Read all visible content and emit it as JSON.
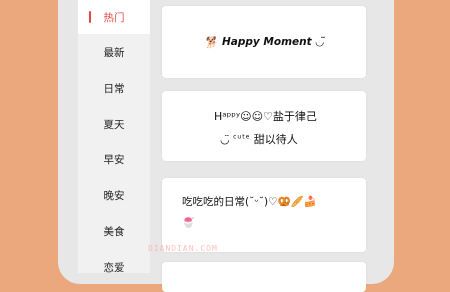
{
  "sidebar": {
    "items": [
      {
        "label": "热门",
        "active": true
      },
      {
        "label": "最新"
      },
      {
        "label": "日常"
      },
      {
        "label": "夏天"
      },
      {
        "label": "早安"
      },
      {
        "label": "晚安"
      },
      {
        "label": "美食"
      },
      {
        "label": "恋爱"
      }
    ]
  },
  "cards": [
    {
      "icon": "🐕",
      "text": "Happy Moment",
      "suffix": "◡̈"
    },
    {
      "line1_prefix": "Hᵃᵖᵖʸ☺︎☺︎♡",
      "line1": "盐于律己",
      "line2_prefix": "◡̈",
      "line2_sup": "cute",
      "line2": "甜以待人"
    },
    {
      "line1": "吃吃吃的日常(˘ᵕ˘)♡🥨🥖🍰",
      "icon": "🍧"
    }
  ],
  "watermark": "DIANDIAN.COM",
  "colors": {
    "background": "#eca87d",
    "accent": "#e04848"
  }
}
